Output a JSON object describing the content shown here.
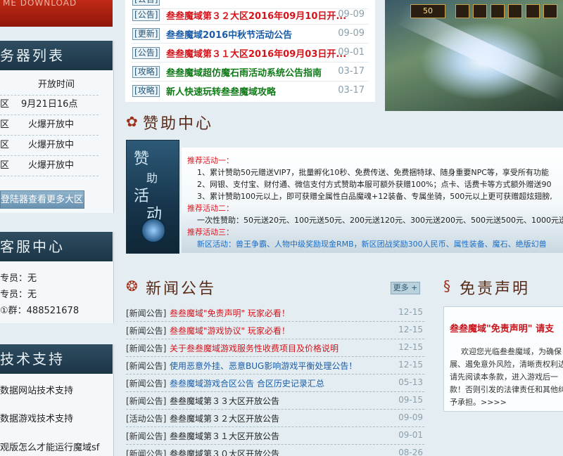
{
  "left": {
    "download_banner": "ME DOWNLOAD",
    "server_list": {
      "title": "务器列表",
      "header": {
        "c1": "",
        "c2": "开放时间"
      },
      "rows": [
        {
          "c1": "区",
          "c2": "9月21日16点"
        },
        {
          "c1": "区",
          "c2": "火爆开放中"
        },
        {
          "c1": "区",
          "c2": "火爆开放中"
        },
        {
          "c1": "区",
          "c2": "火爆开放中"
        }
      ],
      "more_button": "登陆器查看更多大区"
    },
    "customer_service": {
      "title": "客服中心",
      "lines": [
        "专员：无",
        "专员：无",
        "①群：488521678"
      ]
    },
    "tech_support": {
      "title": "技术支持",
      "lines": [
        "数据网站技术支持",
        "数据游戏技术支持",
        "观版怎么才能运行魔域sf"
      ]
    }
  },
  "top_notices": [
    {
      "tag": "公告",
      "title": "",
      "date": "",
      "color": "red"
    },
    {
      "tag": "公告",
      "title": "叁叁魔域第３２大区2016年09月10日开...",
      "date": "09-09",
      "color": "red"
    },
    {
      "tag": "更新",
      "title": "叁叁魔域2016中秋节活动公告",
      "date": "09-09",
      "color": "blue"
    },
    {
      "tag": "公告",
      "title": "叁叁魔域第３１大区2016年09月03日开...",
      "date": "09-01",
      "color": "red"
    },
    {
      "tag": "攻略",
      "title": "叁叁魔域超仿魔石雨活动系统公告指南",
      "date": "03-17",
      "color": "green"
    },
    {
      "tag": "攻略",
      "title": "新人快速玩转叁叁魔域攻略",
      "date": "03-17",
      "color": "green"
    }
  ],
  "game_hud": [
    "50"
  ],
  "sponsor": {
    "title": "赞助中心",
    "image_text": [
      "赞",
      "助",
      "活",
      "动"
    ],
    "lines": [
      {
        "kind": "head",
        "text": "推荐活动一："
      },
      {
        "kind": "body",
        "text": "1、累计赞助50元赠送VIP7，批量孵化10秒、免费传送、免费捆特球、随身重要NPC等，享受所有功能"
      },
      {
        "kind": "body",
        "text": "2、网银、支付宝、财付通、微信支付方式赞助本服可额外获赠100%；点卡、话费卡等方式额外赠送90"
      },
      {
        "kind": "body",
        "text": "3、累计赞助100元以上，即可获赠全属性白品魔魂+12装备、专属坐骑，500元以上更可获赠超炫翅膀,"
      },
      {
        "kind": "head",
        "text": "推荐活动二："
      },
      {
        "kind": "body",
        "text": "一次性赞助：50元送20元、100元送50元、200元送120元、300元送200元、500元送500元、1000元送"
      },
      {
        "kind": "head",
        "text": "推荐活动三："
      },
      {
        "kind": "blue",
        "text": "新区活动：兽王争霸、人物中级奖励现金RMB，新区团战奖励300人民币、属性装备、魔石、绝版幻兽"
      }
    ]
  },
  "news": {
    "title": "新闻公告",
    "more": "更多 +",
    "items": [
      {
        "cat": "[新闻公告]",
        "title": "叁叁魔域\"免责声明\" 玩家必看！",
        "date": "12-15",
        "color": "red"
      },
      {
        "cat": "[新闻公告]",
        "title": "叁叁魔域\"游戏协议\" 玩家必看！",
        "date": "12-15",
        "color": "red"
      },
      {
        "cat": "[新闻公告]",
        "title": "关于叁叁魔域游戏服务性收费项目及价格说明",
        "date": "12-15",
        "color": "red"
      },
      {
        "cat": "[新闻公告]",
        "title": "使用恶意外挂、恶意BUG影响游戏平衡处理公告！",
        "date": "12-15",
        "color": "blue"
      },
      {
        "cat": "[新闻公告]",
        "title": "叁叁魔域游戏合区公告 合区历史记录汇总",
        "date": "05-13",
        "color": "blue"
      },
      {
        "cat": "[新闻公告]",
        "title": "叁叁魔域第３３大区开放公告",
        "date": "09-15",
        "color": "dark"
      },
      {
        "cat": "[活动公告]",
        "title": "叁叁魔域第３２大区开放公告",
        "date": "09-09",
        "color": "dark"
      },
      {
        "cat": "[新闻公告]",
        "title": "叁叁魔域第３１大区开放公告",
        "date": "09-01",
        "color": "dark"
      },
      {
        "cat": "[新闻公告]",
        "title": "叁叁魔域第３０大区开放公告",
        "date": "08-26",
        "color": "dark"
      }
    ]
  },
  "disclaimer": {
    "title": "免责声明",
    "box_title": "叁叁魔域\"免责声明\" 请支",
    "lines": [
      "欢迎您光临叁叁魔域，为确保",
      "展、遏免意外风险，清晰责权利边",
      "请先阅读本条款，进入游戏后一",
      "款！否则引发的法律责任和其他纠",
      "予承担。>>>>"
    ]
  }
}
